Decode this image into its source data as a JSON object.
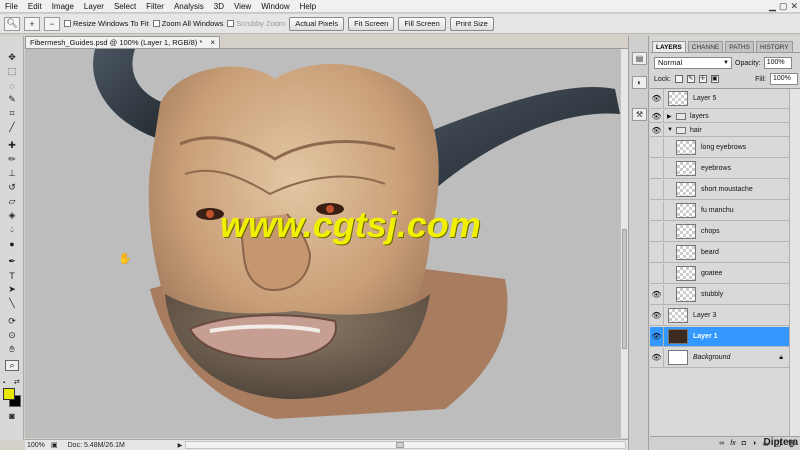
{
  "menu": {
    "items": [
      "File",
      "Edit",
      "Image",
      "Layer",
      "Select",
      "Filter",
      "Analysis",
      "3D",
      "View",
      "Window",
      "Help"
    ]
  },
  "options": {
    "zoom_icon": "zoom-tool-icon",
    "resize_windows": "Resize Windows To Fit",
    "zoom_all_windows": "Zoom All Windows",
    "scrubby_zoom": "Scrubby Zoom",
    "actual_pixels": "Actual Pixels",
    "fit_screen": "Fit Screen",
    "fill_screen": "Fill Screen",
    "print_size": "Print Size"
  },
  "document": {
    "tab_title": "Fibermesh_Guides.psd @ 100% (Layer 1, RGB/8) *",
    "close": "×",
    "zoom": "100%",
    "doc_info": "Doc: 5.48M/26.1M",
    "watermark": "www.cgtsj.com"
  },
  "colors": {
    "foreground": "#e8e800",
    "background": "#000000",
    "selection": "#3398ff",
    "watermark": "#f0f000"
  },
  "panel": {
    "tabs": [
      "LAYERS",
      "CHANNE",
      "PATHS",
      "HISTORY"
    ],
    "blend_mode": "Normal",
    "opacity_label": "Opacity:",
    "opacity": "100%",
    "lock_label": "Lock:",
    "fill_label": "Fill:",
    "fill": "100%",
    "layers": [
      {
        "name": "Layer 5",
        "visible": true,
        "kind": "layer"
      },
      {
        "name": "layers",
        "visible": true,
        "kind": "group",
        "expanded": false
      },
      {
        "name": "hair",
        "visible": true,
        "kind": "group",
        "expanded": true
      },
      {
        "name": "long eyebrows",
        "visible": false,
        "kind": "layer"
      },
      {
        "name": "eyebrows",
        "visible": false,
        "kind": "layer"
      },
      {
        "name": "short moustache",
        "visible": false,
        "kind": "layer"
      },
      {
        "name": "fu manchu",
        "visible": false,
        "kind": "layer"
      },
      {
        "name": "chops",
        "visible": false,
        "kind": "layer"
      },
      {
        "name": "beard",
        "visible": false,
        "kind": "layer"
      },
      {
        "name": "goatee",
        "visible": false,
        "kind": "layer"
      },
      {
        "name": "stubbly",
        "visible": true,
        "kind": "layer"
      },
      {
        "name": "Layer 3",
        "visible": true,
        "kind": "layer"
      },
      {
        "name": "Layer 1",
        "visible": true,
        "kind": "layer",
        "selected": true
      },
      {
        "name": "Background",
        "visible": true,
        "kind": "layer",
        "locked": true
      }
    ],
    "bottom_icons": [
      "link-icon",
      "fx-icon",
      "mask-icon",
      "adjustment-icon",
      "folder-icon",
      "new-layer-icon",
      "trash-icon"
    ]
  },
  "brand": "Diptera"
}
